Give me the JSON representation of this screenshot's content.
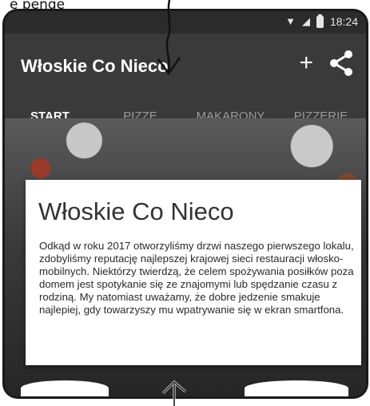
{
  "annotation_text": "ę pengę",
  "status_bar": {
    "time": "18:24",
    "icons": [
      "wifi-icon",
      "signal-icon",
      "battery-icon"
    ]
  },
  "app_bar": {
    "title": "Włoskie Co Nieco",
    "actions": [
      {
        "name": "add",
        "icon": "plus-icon",
        "label": "+"
      },
      {
        "name": "share",
        "icon": "share-icon"
      }
    ]
  },
  "tabs": [
    {
      "label": "START",
      "active": true
    },
    {
      "label": "PIZZE",
      "active": false
    },
    {
      "label": "MAKARONY",
      "active": false
    },
    {
      "label": "PIZZERIE",
      "active": false
    }
  ],
  "card": {
    "title": "Włoskie Co Nieco",
    "body": "Odkąd w roku 2017 otworzyliśmy drzwi naszego pierwszego lokalu, zdobyliśmy reputację najlepszej krajowej sieci restauracji włosko-mobilnych. Niektórzy twierdzą, że celem spożywania posiłków poza domem jest spotykanie się ze znajomymi lub spędzanie czasu z rodziną. My natomiast uważamy, że dobre jedzenie smakuje najlepiej, gdy towarzyszy mu wpatrywanie się w ekran smartfona."
  },
  "colors": {
    "app_bar": "#3a3a3a",
    "status_bar": "#2b2b2b",
    "active_tab": "#ffffff",
    "inactive_tab": "#9a9a9a"
  }
}
